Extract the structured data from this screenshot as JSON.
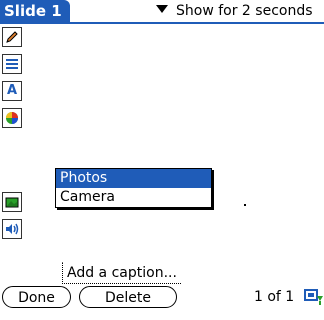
{
  "header": {
    "title": "Slide 1",
    "show_duration_label": "Show for 2 seconds"
  },
  "toolbar": {
    "tools": [
      {
        "name": "pencil-icon"
      },
      {
        "name": "lines-icon"
      },
      {
        "name": "text-tool-icon",
        "label": "A"
      },
      {
        "name": "color-palette-icon"
      },
      {
        "name": "photo-icon"
      },
      {
        "name": "sound-icon"
      }
    ]
  },
  "menu": {
    "items": [
      "Photos",
      "Camera"
    ],
    "selected": "Photos"
  },
  "caption": {
    "placeholder": "Add a caption..."
  },
  "buttons": {
    "done": "Done",
    "delete": "Delete"
  },
  "pager": {
    "text": "1 of 1"
  },
  "colors": {
    "accent": "#1f5cb8"
  }
}
